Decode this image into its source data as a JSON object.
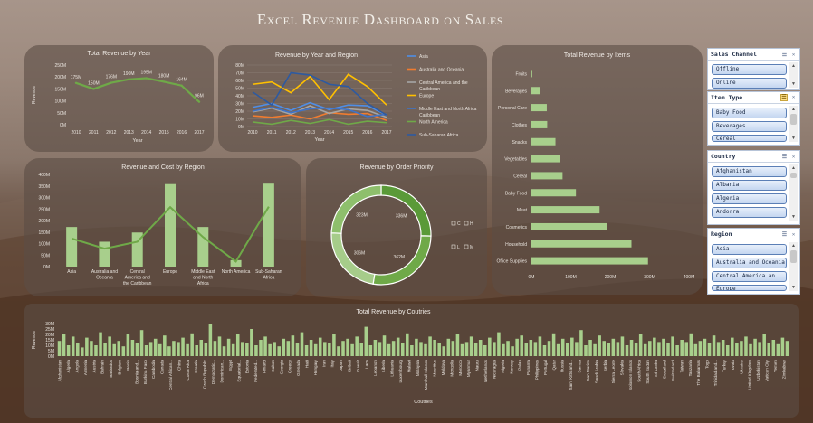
{
  "page_title": "Excel Revenue Dashboard on Sales",
  "colors": {
    "accent_green": "#6fa948",
    "light_green": "#a8cf8c",
    "panel": "#5c4e46"
  },
  "chart_data": [
    {
      "id": "by_year",
      "type": "line",
      "title": "Total Revenue by Year",
      "xlabel": "Year",
      "ylabel": "Revenue",
      "x": [
        "2010",
        "2011",
        "2012",
        "2013",
        "2014",
        "2015",
        "2016",
        "2017"
      ],
      "values": [
        175,
        150,
        176,
        190,
        195,
        180,
        164,
        96
      ],
      "data_labels": [
        "175M",
        "150M",
        "176M",
        "190M",
        "195M",
        "180M",
        "164M",
        "96M"
      ],
      "yticks": [
        "0M",
        "50M",
        "100M",
        "150M",
        "200M",
        "250M"
      ],
      "ylim": [
        0,
        250
      ]
    },
    {
      "id": "by_year_region",
      "type": "line",
      "title": "Revenue by Year and Region",
      "xlabel": "Year",
      "x": [
        "2010",
        "2011",
        "2012",
        "2013",
        "2014",
        "2015",
        "2016",
        "2017"
      ],
      "yticks": [
        "0M",
        "10M",
        "20M",
        "30M",
        "40M",
        "50M",
        "60M",
        "70M",
        "80M"
      ],
      "ylim": [
        0,
        80
      ],
      "legend_position": "right",
      "series": [
        {
          "name": "Asia",
          "color": "#4f8ee6",
          "values": [
            25,
            30,
            21,
            31,
            22,
            28,
            27,
            15
          ]
        },
        {
          "name": "Australia and Oceania",
          "color": "#f07c30",
          "values": [
            14,
            12,
            15,
            10,
            18,
            16,
            17,
            8
          ]
        },
        {
          "name": "Central America and the Caribbean",
          "color": "#a5a5a5",
          "values": [
            19,
            24,
            16,
            27,
            17,
            23,
            21,
            12
          ]
        },
        {
          "name": "Europe",
          "color": "#ffc000",
          "values": [
            55,
            58,
            44,
            65,
            35,
            68,
            52,
            28
          ]
        },
        {
          "name": "Middle East and North Africa",
          "color": "#3f73c7",
          "values": [
            20,
            25,
            18,
            23,
            24,
            22,
            13,
            16
          ]
        },
        {
          "name": "North America",
          "color": "#6fa948",
          "values": [
            6,
            3,
            8,
            4,
            9,
            3,
            7,
            5
          ]
        },
        {
          "name": "Sub-Saharan Africa",
          "color": "#2e5aa0",
          "values": [
            45,
            28,
            70,
            67,
            55,
            52,
            30,
            15
          ]
        }
      ]
    },
    {
      "id": "by_items",
      "type": "bar",
      "orientation": "horizontal",
      "title": "Total Revenue by Items",
      "categories": [
        "Fruits",
        "Beverages",
        "Personal Care",
        "Clothes",
        "Snacks",
        "Vegetables",
        "Cereal",
        "Baby Food",
        "Meat",
        "Cosmetics",
        "Household",
        "Office Supplies"
      ],
      "values": [
        2,
        22,
        39,
        40,
        61,
        72,
        79,
        113,
        173,
        191,
        254,
        296
      ],
      "xticks": [
        "0M",
        "100M",
        "200M",
        "300M",
        "400M"
      ],
      "xlim": [
        0,
        400
      ]
    },
    {
      "id": "rev_cost_region",
      "type": "bar",
      "title": "Revenue and Cost by Region",
      "categories": [
        "Asia",
        "Australia and Oceania",
        "Central America and the Caribbean",
        "Europe",
        "Middle East and North Africa",
        "North America",
        "Sub-Saharan Africa"
      ],
      "series": [
        {
          "name": "Revenue",
          "values": [
            172,
            108,
            148,
            358,
            172,
            28,
            360
          ]
        },
        {
          "name": "Cost",
          "values": [
            122,
            78,
            108,
            258,
            128,
            22,
            260
          ]
        }
      ],
      "yticks": [
        "0M",
        "50M",
        "100M",
        "150M",
        "200M",
        "250M",
        "300M",
        "350M",
        "400M"
      ],
      "ylim": [
        0,
        400
      ]
    },
    {
      "id": "by_priority",
      "type": "pie",
      "donut": true,
      "title": "Revenue by Order Priority",
      "labels": [
        "C",
        "H",
        "L",
        "M"
      ],
      "values": [
        323,
        336,
        306,
        362
      ],
      "data_labels": [
        "323M",
        "336M",
        "306M",
        "362M"
      ],
      "legend_position": "right"
    },
    {
      "id": "by_countries",
      "type": "bar",
      "title": "Total Revenue by Coutries",
      "xlabel": "Coutries",
      "ylabel": "Revenue",
      "yticks": [
        "0M",
        "5M",
        "10M",
        "15M",
        "20M",
        "25M",
        "30M"
      ],
      "ylim": [
        0,
        30
      ],
      "categories_shown": [
        "Afghanistan",
        "Algeria",
        "Angola",
        "Armenia",
        "Austria",
        "Bahrain",
        "Barbados",
        "Belgium",
        "Benin",
        "Bosnia and...",
        "Burkina Faso",
        "Cambodia",
        "Canada",
        "Central African...",
        "China",
        "Costa Rica",
        "Croatia",
        "Czech Republic",
        "Democratic...",
        "Dominican...",
        "Egypt",
        "Equatorial...",
        "Estonia",
        "Federated...",
        "Finland",
        "Gabon",
        "Georgia",
        "Greece",
        "Grenada",
        "Haiti",
        "Hungary",
        "Iran",
        "Italy",
        "Japan",
        "Kiribati",
        "Kuwait",
        "Laos",
        "Lebanon",
        "Liberia",
        "Lithuania",
        "Luxembourg",
        "Malawi",
        "Malaysia",
        "Marshall Islands",
        "Mauritius",
        "Moldova",
        "Mongolia",
        "Morocco",
        "Myanmar",
        "Nauru",
        "Netherlands",
        "Nicaragua",
        "Nigeria",
        "Norway",
        "Palau",
        "Panama",
        "Philippines",
        "Portugal",
        "Qatar",
        "Russia",
        "Saint Kitts and...",
        "Samoa",
        "San Marino",
        "Saudi Arabia",
        "Serbia",
        "Sierra Leone",
        "Slovakia",
        "Solomon Islands",
        "South Africa",
        "South Sudan",
        "Sri Lanka",
        "Swaziland",
        "Switzerland",
        "Taiwan",
        "Tanzania",
        "The Bahamas",
        "Togo",
        "Trinidad and...",
        "Turkey",
        "Tuvalu",
        "Ukraine",
        "United Kingdom",
        "Uzbekistan",
        "Vatican City",
        "Yemen",
        "Zimbabwe"
      ],
      "values": [
        14,
        20,
        10,
        18,
        12,
        8,
        17,
        14,
        10,
        22,
        12,
        18,
        11,
        14,
        9,
        20,
        15,
        12,
        24,
        10,
        13,
        16,
        11,
        19,
        9,
        14,
        13,
        17,
        11,
        21,
        10,
        15,
        12,
        30,
        14,
        18,
        9,
        16,
        11,
        20,
        13,
        12,
        25,
        10,
        15,
        18,
        11,
        13,
        9,
        16,
        14,
        19,
        12,
        22,
        10,
        15,
        11,
        17,
        13,
        12,
        20,
        9,
        14,
        16,
        11,
        18,
        12,
        27,
        10,
        15,
        13,
        19,
        11,
        14,
        17,
        12,
        21,
        10,
        16,
        13,
        11,
        18,
        15,
        12,
        9,
        16,
        14,
        20,
        11,
        13,
        18,
        12,
        15,
        10,
        17,
        13,
        22,
        11,
        14,
        9,
        16,
        19,
        12,
        15,
        13,
        18,
        10,
        14,
        21,
        11,
        16,
        12,
        17,
        13,
        24,
        10,
        15,
        11,
        19,
        14,
        12,
        16,
        13,
        18,
        10,
        15,
        12,
        20,
        11,
        14,
        17,
        13,
        16,
        12,
        18,
        10,
        15,
        13,
        21,
        11,
        14,
        16,
        12,
        19,
        13,
        15,
        10,
        17,
        12,
        14,
        18,
        11,
        16,
        13,
        20,
        12,
        15,
        11,
        17,
        14
      ]
    }
  ],
  "slicers": [
    {
      "title": "Sales Channel",
      "items": [
        "Offline",
        "Online"
      ]
    },
    {
      "title": "Item Type",
      "items": [
        "Baby Food",
        "Beverages",
        "Cereal"
      ]
    },
    {
      "title": "Country",
      "items": [
        "Afghanistan",
        "Albania",
        "Algeria",
        "Andorra"
      ]
    },
    {
      "title": "Region",
      "items": [
        "Asia",
        "Australia and Oceania",
        "Central America an...",
        "Europe"
      ]
    }
  ]
}
